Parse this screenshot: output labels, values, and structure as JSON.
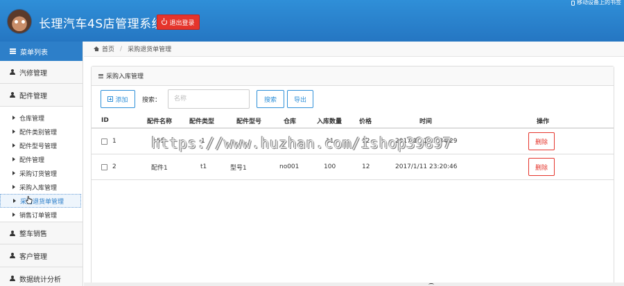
{
  "header": {
    "title": "长理汽车4S店管理系统",
    "logout_label": "退出登录",
    "top_right_text": "移动设备上的书签"
  },
  "sidebar": {
    "menu_title": "菜单列表",
    "groups": [
      {
        "label": "汽修管理"
      },
      {
        "label": "配件管理"
      },
      {
        "label": "整车销售"
      },
      {
        "label": "客户管理"
      },
      {
        "label": "数据统计分析"
      }
    ],
    "sub_items": [
      {
        "label": "仓库管理"
      },
      {
        "label": "配件类别管理"
      },
      {
        "label": "配件型号管理"
      },
      {
        "label": "配件管理"
      },
      {
        "label": "采购订货管理"
      },
      {
        "label": "采购入库管理"
      },
      {
        "label": "采购退货单管理",
        "active": true
      },
      {
        "label": "销售订单管理"
      }
    ]
  },
  "breadcrumb": {
    "home": "首页",
    "current": "采购退货单管理"
  },
  "panel": {
    "title": "采购入库管理",
    "add_label": "添加",
    "search_label": "搜索：",
    "search_placeholder": "名称",
    "search_button": "搜索",
    "export_button": "导出"
  },
  "table": {
    "headers": [
      "ID",
      "配件名称",
      "配件类型",
      "配件型号",
      "仓库",
      "入库数量",
      "价格",
      "时间",
      "操作"
    ],
    "rows": [
      {
        "id": "1",
        "name": "55",
        "type": "1",
        "model": "",
        "warehouse": "",
        "qty": "11",
        "price": "12",
        "time": "2017/1/11 23:34:29",
        "action": "删除"
      },
      {
        "id": "2",
        "name": "配件1",
        "type": "t1",
        "model": "型号1",
        "warehouse": "no001",
        "qty": "100",
        "price": "12",
        "time": "2017/1/11 23:20:46",
        "action": "删除"
      }
    ]
  },
  "watermark": "https://www.huzhan.com/ishop39897",
  "colors": {
    "header_blue": "#2576c2",
    "menu_blue": "#2d7fc9",
    "danger_red": "#e5342b"
  }
}
